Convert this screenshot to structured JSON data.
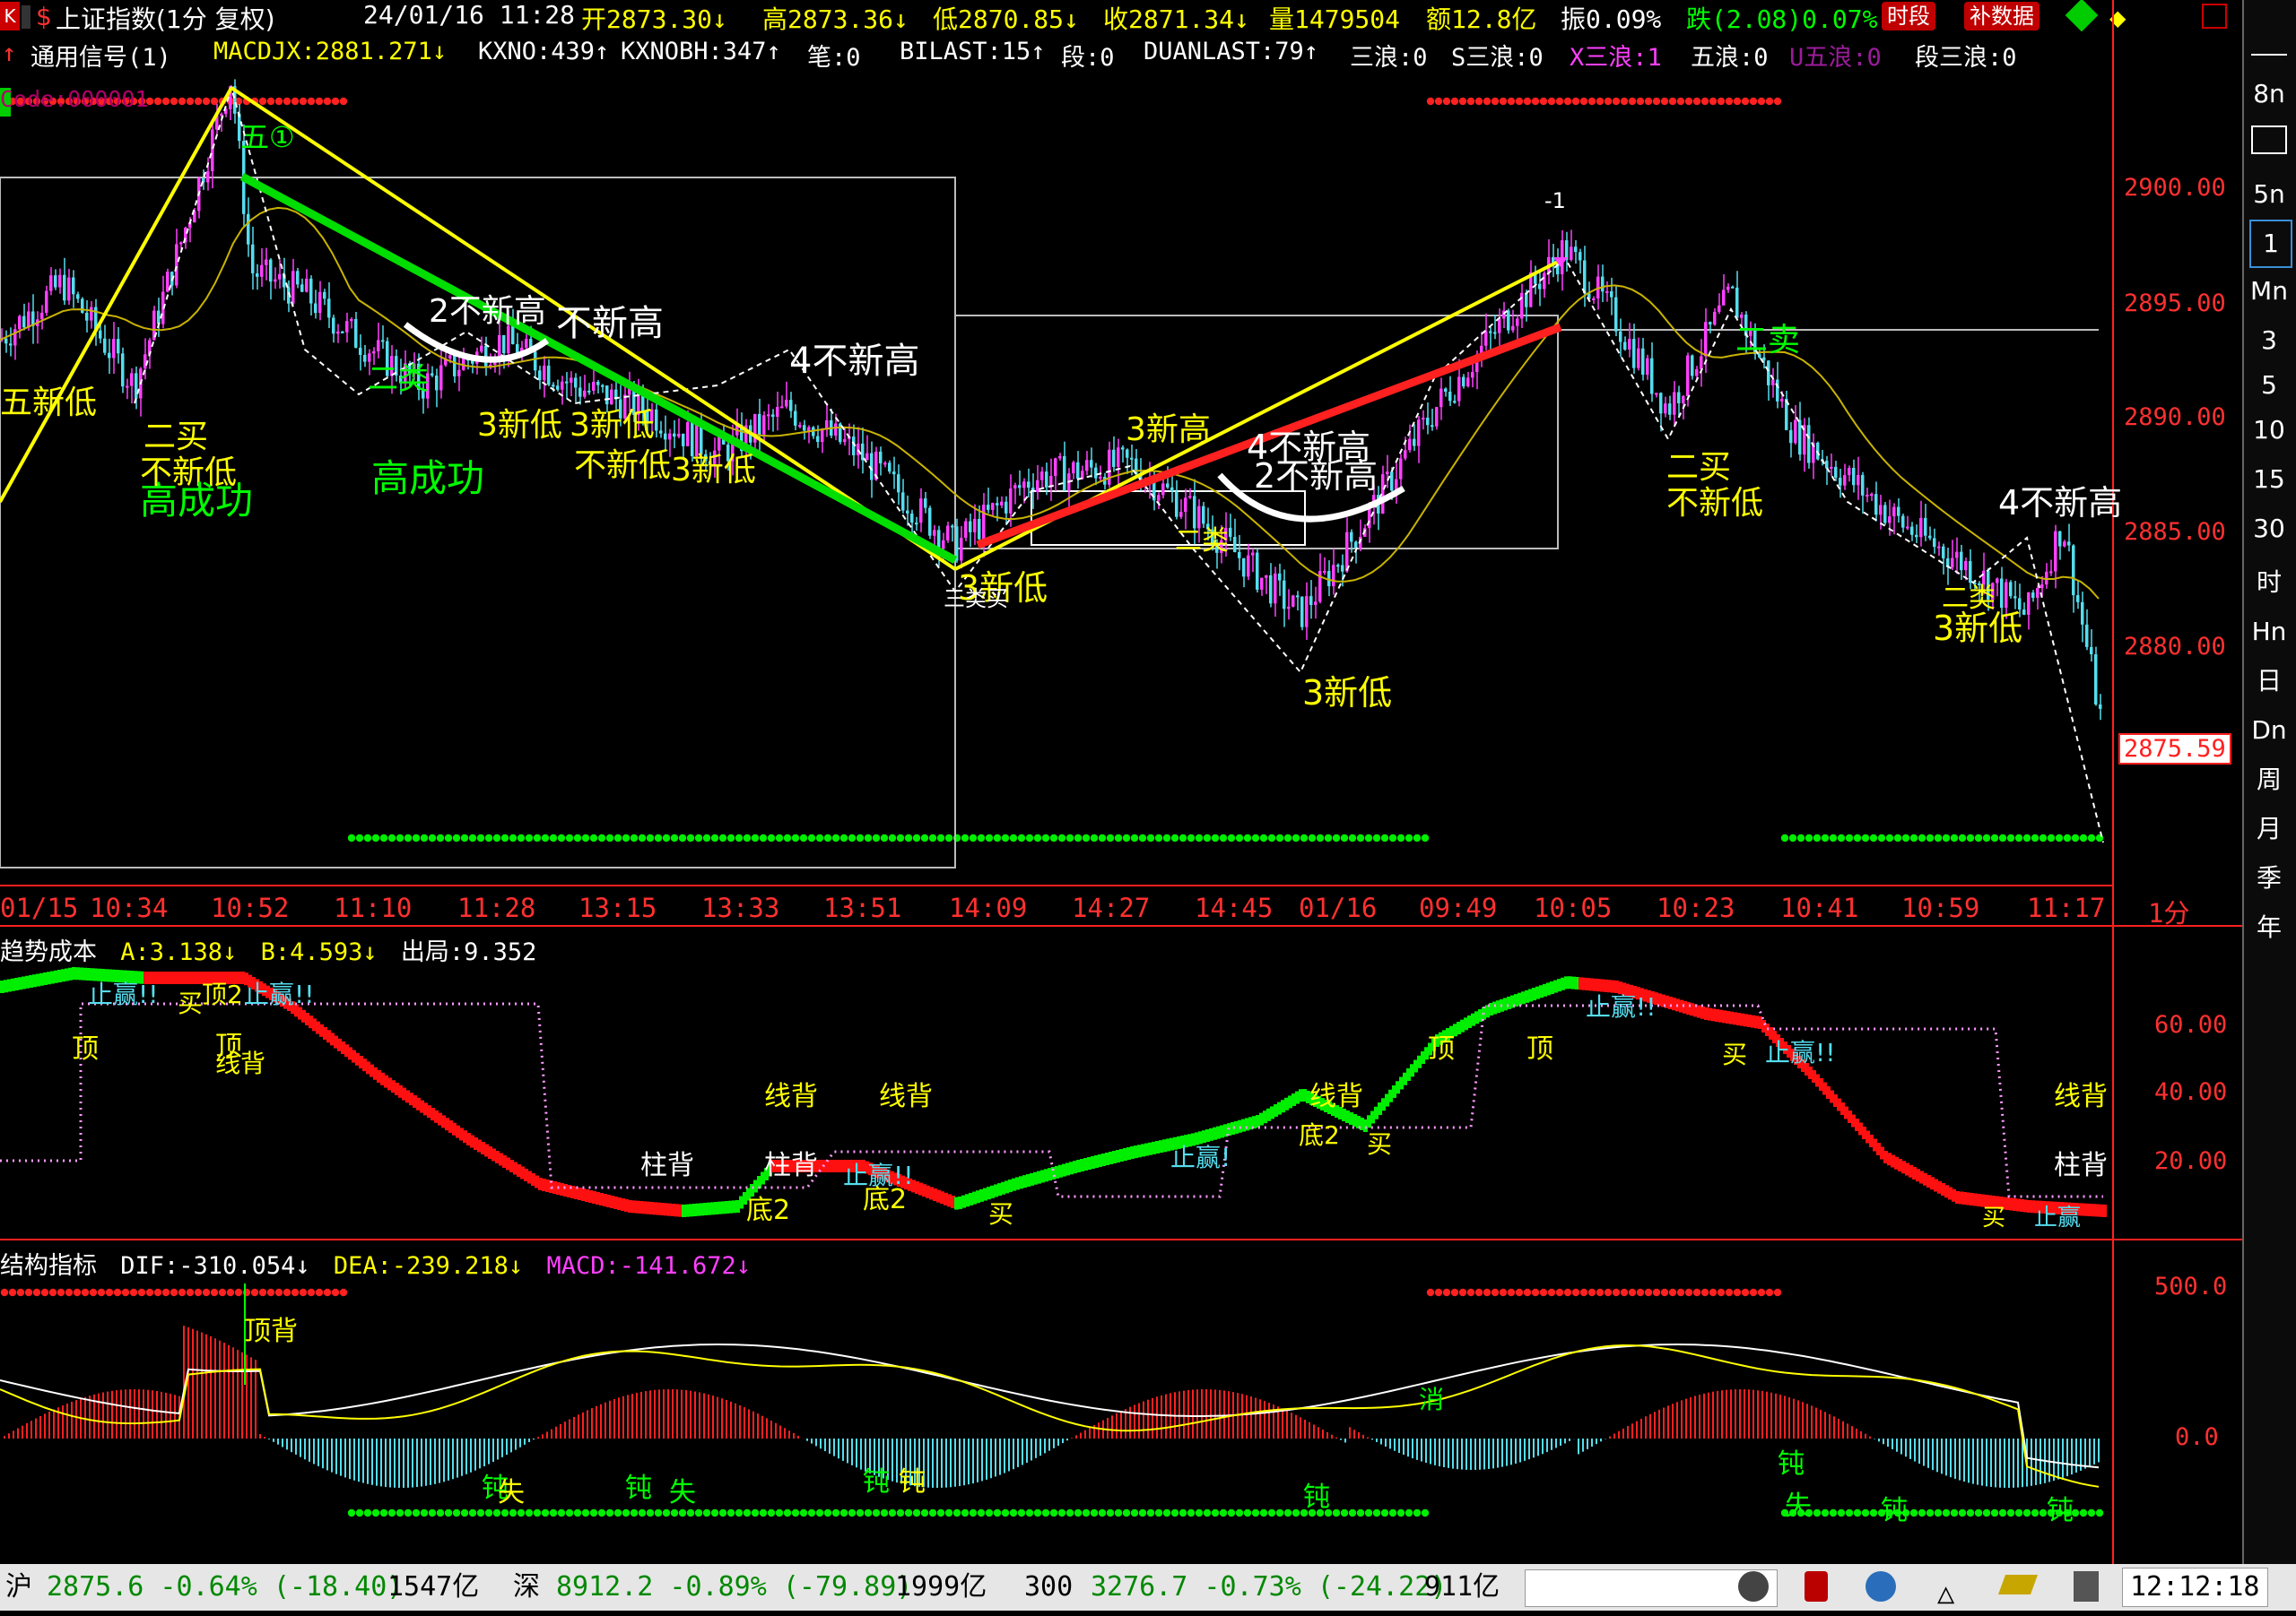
{
  "header": {
    "icon_k": "K",
    "title": "上证指数(1分 复权)",
    "datetime": "24/01/16 11:28",
    "open": "开2873.30↓",
    "high": "高2873.36↓",
    "low": "低2870.85↓",
    "close": "收2871.34↓",
    "volume": "量1479504",
    "amount": "额12.8亿",
    "amplitude": "振0.09%",
    "change": "跌(2.08)0.07%",
    "btn_period": "时段",
    "btn_fill": "补数据"
  },
  "signal_bar": {
    "label": "通用信号(1)",
    "macdjx": "MACDJX:2881.271↓",
    "kxno": "KXNO:439↑",
    "kxnobh": "KXNOBH:347↑",
    "bi": "笔:0",
    "bilast": "BILAST:15↑",
    "duan": "段:0",
    "duanlast": "DUANLAST:79↑",
    "sanlang": "三浪:0",
    "s_sanlang": "S三浪:0",
    "x_sanlang": "X三浪:1",
    "wulang": "五浪:0",
    "u_wulang": "U五浪:0",
    "duan_sanlang": "段三浪:0"
  },
  "code_label": "Code:000001",
  "price_axis": [
    "2900.00",
    "2895.00",
    "2890.00",
    "2885.00",
    "2880.00"
  ],
  "price_axis_values": [
    2900,
    2895,
    2890,
    2885,
    2880
  ],
  "current_price": "2875.59",
  "x_axis": [
    "01/15",
    "10:34",
    "10:52",
    "11:10",
    "11:28",
    "13:15",
    "13:33",
    "13:51",
    "14:09",
    "14:27",
    "14:45",
    "01/16",
    "09:49",
    "10:05",
    "10:23",
    "10:41",
    "10:59",
    "11:17"
  ],
  "period_label": "1分",
  "chart_annotations": {
    "wu_circle": "五①",
    "wu_xindi": "五新低",
    "er_mai_1": "二买",
    "bu_xindi_1": "不新低",
    "gao_chenggong_1": "高成功",
    "gao_chenggong_2": "高成功",
    "er_bu_xingao_1": "2不新高",
    "bu_xingao_1": "不新高",
    "er_lei": "二类",
    "san_xindi_1": "3新低",
    "san_xindi_2": "3新低",
    "bu_xindi_2": "不新低",
    "san_xindi_3": "3新低",
    "si_bu_xingao_1": "4不新高",
    "san_xindi_4": "3新低",
    "san_xingao": "3新高",
    "si_bu_xingao_2": "4不新高",
    "er_bu_xingao_2": "2不新高",
    "san_xindi_5": "3新低",
    "er_mai_2": "二买",
    "bu_xindi_3": "不新低",
    "er_mai_3": "二卖",
    "si_bu_xingao_3": "4不新高",
    "san_xindi_6": "3新低",
    "er_lei_2": "二类",
    "er_lei_3": "二类",
    "lei_mai": "三类买",
    "marker_top": "-1"
  },
  "trend_cost": {
    "title": "趋势成本",
    "a": "A:3.138↓",
    "b": "B:4.593↓",
    "exit": "出局:9.352",
    "axis": [
      "60.00",
      "40.00",
      "20.00"
    ],
    "axis_values": [
      60,
      40,
      20
    ],
    "labels": {
      "zhiying1": "止赢!!",
      "mai1": "买",
      "ding2": "顶2",
      "zhiying2": "止赢!!",
      "ding1": "顶",
      "ding3": "顶",
      "xianbei1": "线背",
      "xianbei2": "线背",
      "xianbei3": "线背",
      "xianbei4": "线背",
      "xianbei5": "线背",
      "zhubei1": "柱背",
      "zhubei2": "柱背",
      "zhubei3": "柱背",
      "di2_1": "底2",
      "di2_2": "底2",
      "zhiying3": "止赢!!",
      "mai2": "买",
      "zhiying4": "止赢!",
      "di2_3": "底2",
      "mai3": "买",
      "ding4": "顶",
      "ding5": "顶",
      "zhiying5": "止赢!!",
      "mai4": "买",
      "zhiying6": "止赢!!",
      "mai5": "买",
      "zhiying7": "止赢"
    }
  },
  "structure": {
    "title": "结构指标",
    "dif": "DIF:-310.054↓",
    "dea": "DEA:-239.218↓",
    "macd": "MACD:-141.672↓",
    "axis": [
      "500.0",
      "0.0"
    ],
    "axis_values": [
      500,
      0
    ],
    "labels": {
      "dingbei": "顶背",
      "dun1": "钝",
      "shi1": "失",
      "dun2": "钝",
      "shi2": "失",
      "dun3": "钝",
      "dun4": "钝",
      "dun5": "钝",
      "xiao": "消",
      "dun6": "钝",
      "shi3": "失",
      "dun7": "钝",
      "dun8": "钝"
    }
  },
  "right_toolbar": [
    "8n",
    "5n",
    "1",
    "Mn",
    "3",
    "5",
    "10",
    "15",
    "30",
    "时",
    "Hn",
    "日",
    "Dn",
    "周",
    "月",
    "季",
    "年"
  ],
  "status_bar": {
    "sh_label": "沪",
    "sh_value": "2875.6 -0.64% (-18.40)",
    "sh_amount": "1547亿",
    "sz_label": "深",
    "sz_value": "8912.2 -0.89% (-79.89)",
    "sz_amount": "1999亿",
    "hs300_label": "300",
    "hs300_value": "3276.7 -0.73% (-24.22)",
    "hs300_amount": "911亿",
    "clock": "12:12:18"
  },
  "colors": {
    "up": "#ff3030",
    "down": "#55ddee",
    "bull_magenta": "#ff40ff",
    "yellow": "#ffff00",
    "green": "#00ff00",
    "axis_red": "#ff2020"
  }
}
